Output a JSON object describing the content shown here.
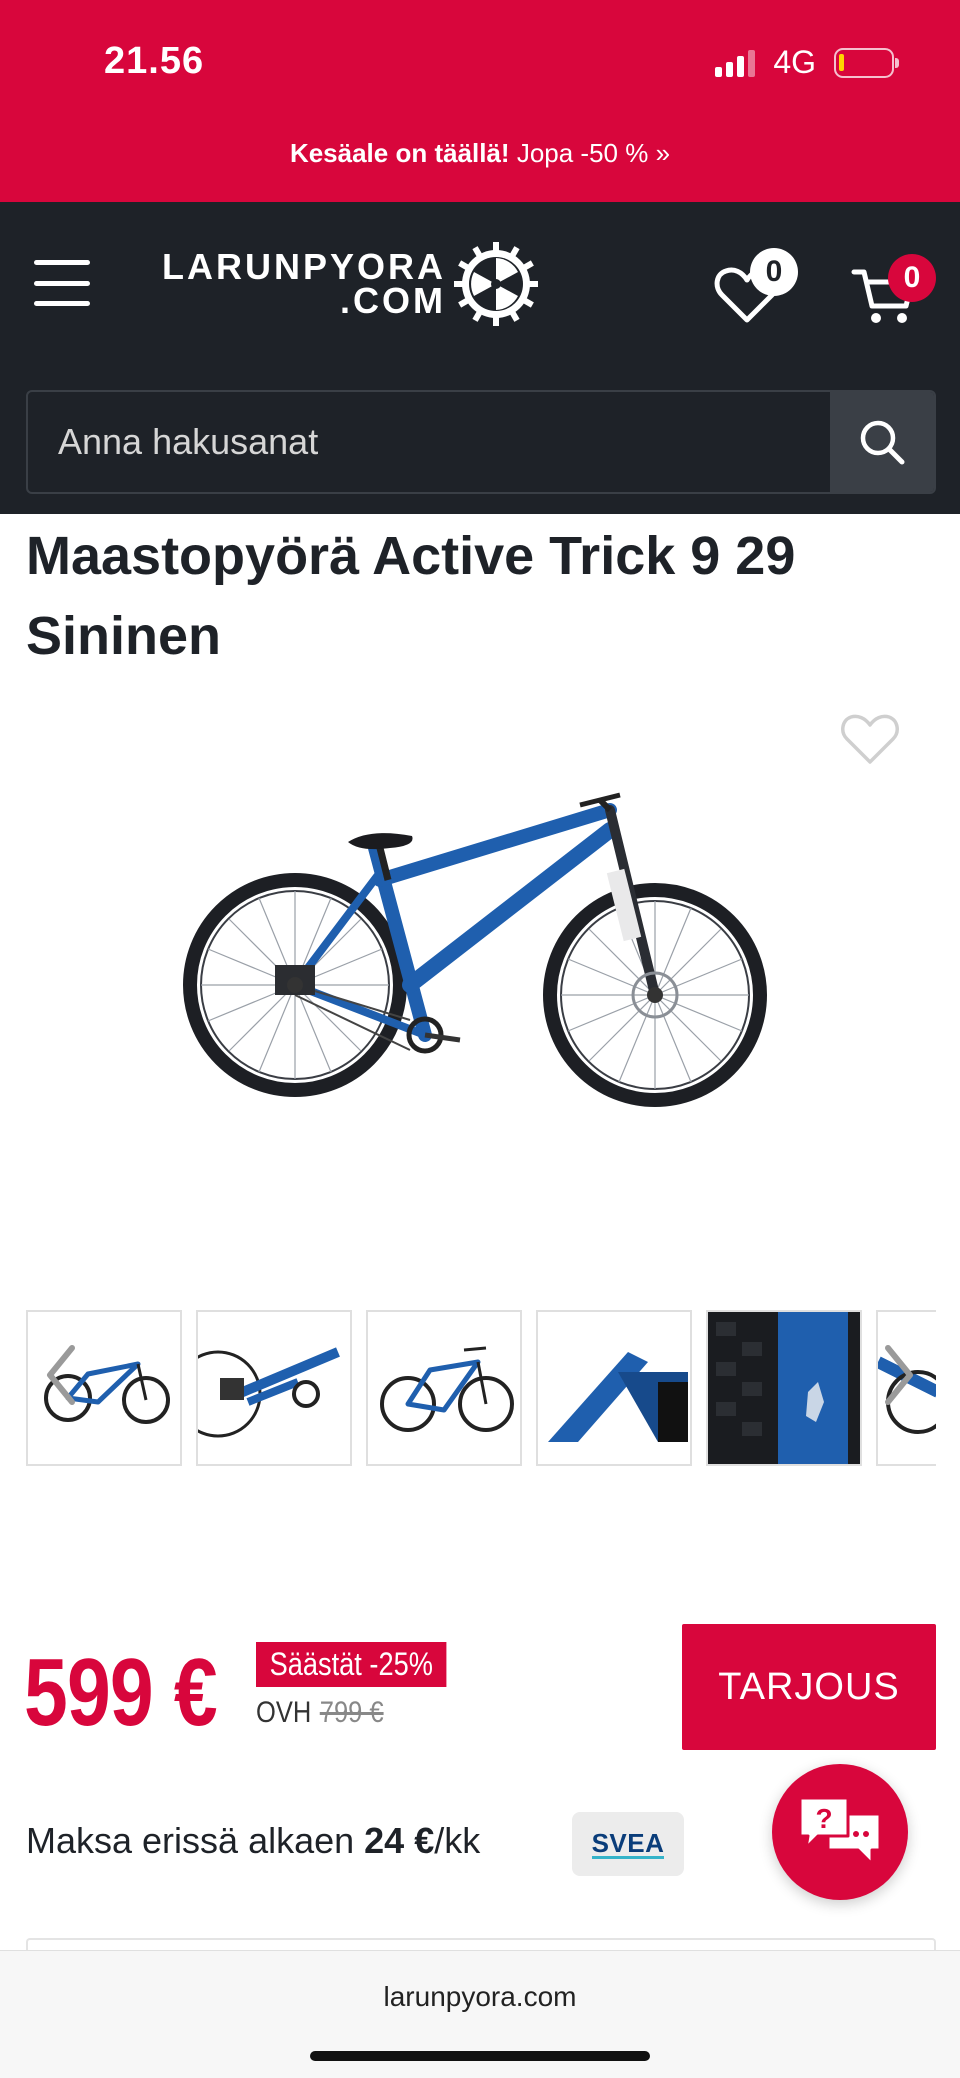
{
  "status_bar": {
    "time": "21.56",
    "network": "4G"
  },
  "promo": {
    "bold": "Kesäale on täällä!",
    "text": "Jopa -50 % »"
  },
  "header": {
    "logo_line1": "LARUNPYORA",
    "logo_line2": ".COM",
    "wishlist_count": "0",
    "cart_count": "0"
  },
  "search": {
    "placeholder": "Anna hakusanat"
  },
  "product": {
    "title": "Maastopyörä Active Trick 9 29 Sininen",
    "price": "599 €",
    "save": "Säästät -25%",
    "ovh_label": "OVH",
    "ovh_price": "799 €",
    "offer_button": "TARJOUS",
    "installment_prefix": "Maksa erissä alkaen ",
    "installment_amount": "24 €",
    "installment_suffix": "/kk",
    "payment_provider": "SVEA"
  },
  "thumbnails": [
    "bike-side",
    "rear-derailleur",
    "bike-side-2",
    "frame-detail",
    "tire-fork-detail",
    "partial"
  ],
  "browser": {
    "url": "larunpyora.com"
  },
  "colors": {
    "brand_red": "#d8063c",
    "header_dark": "#1e2228",
    "bike_blue": "#1f5fae"
  }
}
